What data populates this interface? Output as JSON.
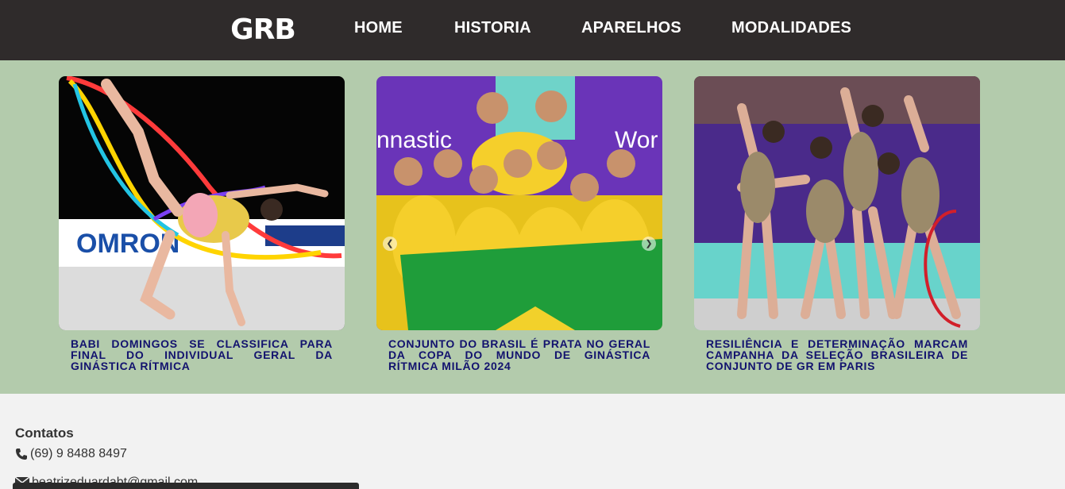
{
  "header": {
    "logo_text": "GRB",
    "nav": [
      {
        "label": "HOME"
      },
      {
        "label": "HISTORIA"
      },
      {
        "label": "APARELHOS"
      },
      {
        "label": "MODALIDADES"
      }
    ]
  },
  "news": [
    {
      "title": "BABI DOMINGOS SE CLASSIFICA PARA FINAL DO INDIVIDUAL GERAL DA GINÁSTICA RÍTMICA",
      "image_text": "OMRON"
    },
    {
      "title": "CONJUNTO DO BRASIL É PRATA NO GERAL DA COPA DO MUNDO DE GINÁSTICA RÍTMICA MILÃO 2024",
      "image_text": "nnastic",
      "image_text2": "Wor"
    },
    {
      "title": "RESILIÊNCIA E DETERMINAÇÃO MARCAM CAMPANHA DA SELEÇÃO BRASILEIRA DE CONJUNTO DE GR EM PARIS"
    }
  ],
  "footer": {
    "title": "Contatos",
    "phone": "(69) 9 8488 8497",
    "email": "beatrizeduardabt@gmail.com"
  },
  "colors": {
    "header_bg": "#2f2b2b",
    "news_bg": "#b3cbac",
    "caption": "#12126e",
    "footer_bg": "#f2f2f2"
  }
}
